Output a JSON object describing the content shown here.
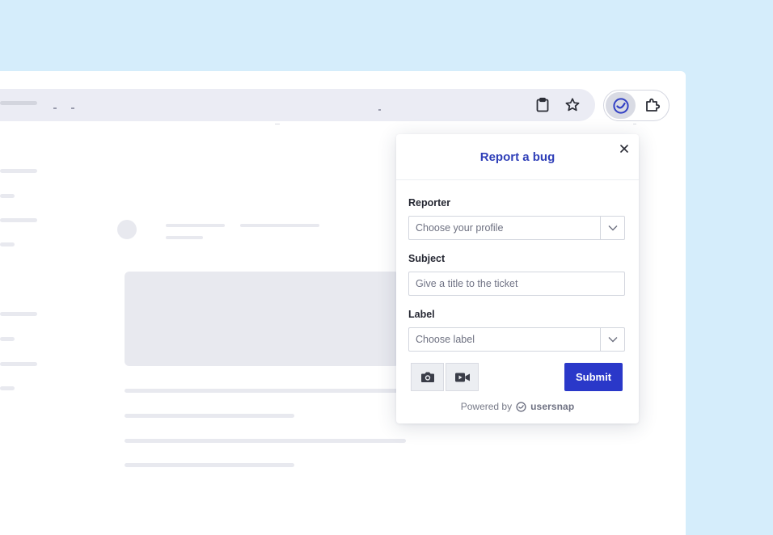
{
  "popup": {
    "title": "Report a bug",
    "close_label": "×",
    "reporter": {
      "label": "Reporter",
      "value": "Choose your profile"
    },
    "subject": {
      "label": "Subject",
      "placeholder": "Give a title to the ticket"
    },
    "label_field": {
      "label": "Label",
      "value": "Choose label"
    },
    "submit_label": "Submit",
    "powered_by": "Powered by",
    "brand": "usersnap"
  },
  "icons": {
    "toolbar": [
      "clipboard-icon",
      "star-icon"
    ],
    "extensions": [
      "usersnap-extension-icon",
      "puzzle-extension-icon"
    ],
    "media": [
      "camera-icon",
      "video-icon"
    ]
  },
  "colors": {
    "accent": "#2a38c9",
    "title": "#2f3fb8",
    "background": "#d5edfb"
  }
}
